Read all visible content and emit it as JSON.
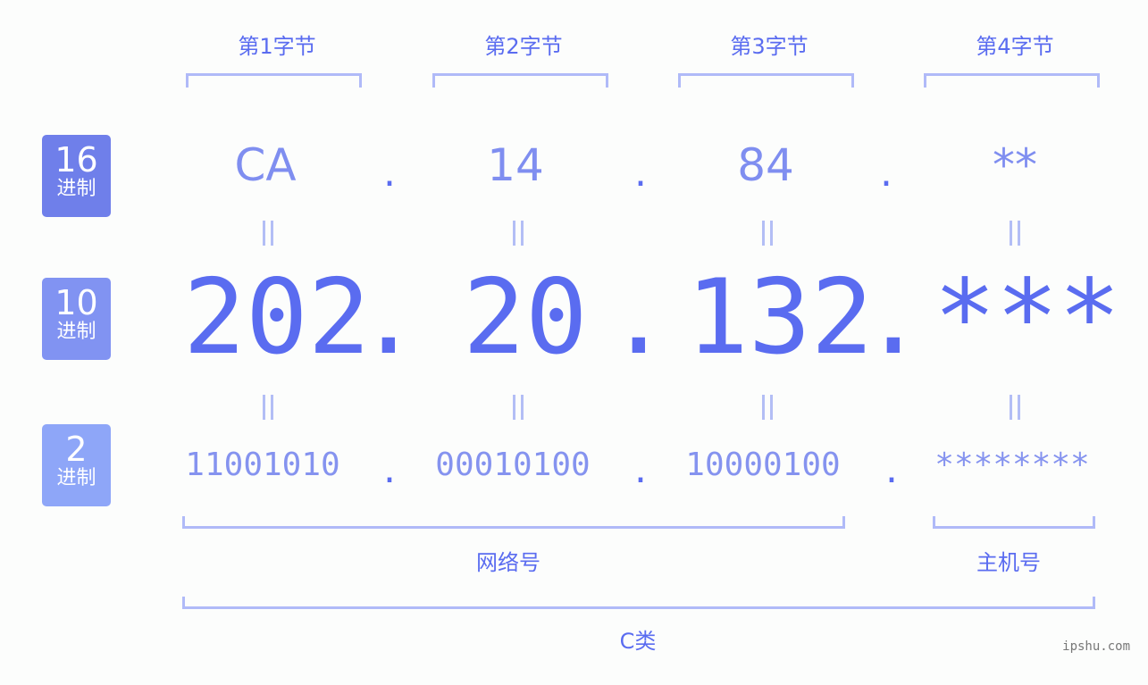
{
  "byte_headers": [
    "第1字节",
    "第2字节",
    "第3字节",
    "第4字节"
  ],
  "badges": [
    {
      "num": "16",
      "label": "进制",
      "color": "#6f7fea"
    },
    {
      "num": "10",
      "label": "进制",
      "color": "#8193f2"
    },
    {
      "num": "2",
      "label": "进制",
      "color": "#8ea6f8"
    }
  ],
  "hex_values": [
    "CA",
    "14",
    "84",
    "**"
  ],
  "dec_values": [
    "202",
    "20",
    "132",
    "***"
  ],
  "bin_values": [
    "11001010",
    "00010100",
    "10000100",
    "********"
  ],
  "separator": ".",
  "equals_symbol": "=",
  "network_label": "网络号",
  "host_label": "主机号",
  "class_label": "C类",
  "watermark": "ipshu.com"
}
